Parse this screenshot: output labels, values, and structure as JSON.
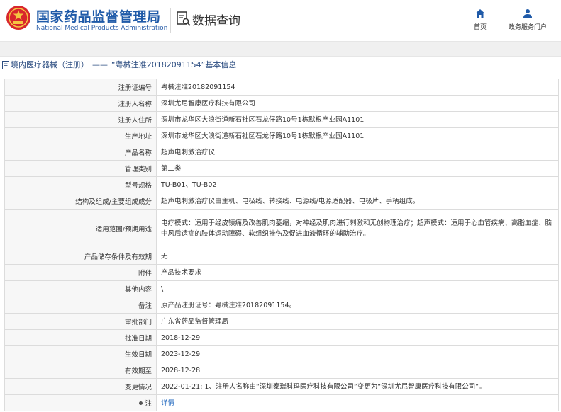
{
  "header": {
    "agency_cn": "国家药品监督管理局",
    "agency_en": "National Medical Products Administration",
    "query_title": "数据查询",
    "nav": [
      {
        "label": "首页",
        "icon": "home-icon"
      },
      {
        "label": "政务服务门户",
        "icon": "user-icon"
      }
    ]
  },
  "breadcrumb": {
    "category": "境内医疗器械（注册）",
    "separator": "——",
    "record": "“粤械注准20182091154”基本信息"
  },
  "details": [
    {
      "label": "注册证编号",
      "value": "粤械注准20182091154"
    },
    {
      "label": "注册人名称",
      "value": "深圳尤尼智康医疗科技有限公司"
    },
    {
      "label": "注册人住所",
      "value": "深圳市龙华区大浪街道新石社区石龙仔路10号1栋默根产业园A1101"
    },
    {
      "label": "生产地址",
      "value": "深圳市龙华区大浪街道新石社区石龙仔路10号1栋默根产业园A1101"
    },
    {
      "label": "产品名称",
      "value": "超声电刺激治疗仪"
    },
    {
      "label": "管理类别",
      "value": "第二类"
    },
    {
      "label": "型号规格",
      "value": "TU-B01、TU-B02"
    },
    {
      "label": "结构及组成/主要组成成分",
      "value": "超声电刺激治疗仪由主机、电极线、转接线、电源线/电源适配器、电极片、手柄组成。"
    },
    {
      "label": "适用范围/预期用途",
      "value": "电疗模式：适用于经皮镇痛及改善肌肉萎缩，对神经及肌肉进行刺激和无创物理治疗；超声模式：适用于心血管疾病、高脂血症、脑中风后遗症的肢体运动障碍、软组织挫伤及促进血液循环的辅助治疗。"
    },
    {
      "label": "产品储存条件及有效期",
      "value": "无"
    },
    {
      "label": "附件",
      "value": "产品技术要求"
    },
    {
      "label": "其他内容",
      "value": "\\"
    },
    {
      "label": "备注",
      "value": "原产品注册证号：粤械注准20182091154。"
    },
    {
      "label": "审批部门",
      "value": "广东省药品监督管理局"
    },
    {
      "label": "批准日期",
      "value": "2018-12-29"
    },
    {
      "label": "生效日期",
      "value": "2023-12-29"
    },
    {
      "label": "有效期至",
      "value": "2028-12-28"
    },
    {
      "label": "变更情况",
      "value": "2022-01-21: 1、注册人名称由“深圳泰瑞科玛医疗科技有限公司”变更为“深圳尤尼智康医疗科技有限公司”。"
    }
  ],
  "note_row": {
    "label": "注",
    "link": "详情"
  },
  "colors": {
    "brand_blue": "#1f5aa8",
    "emblem_red": "#d8262c",
    "link_blue": "#2b6fc2"
  }
}
